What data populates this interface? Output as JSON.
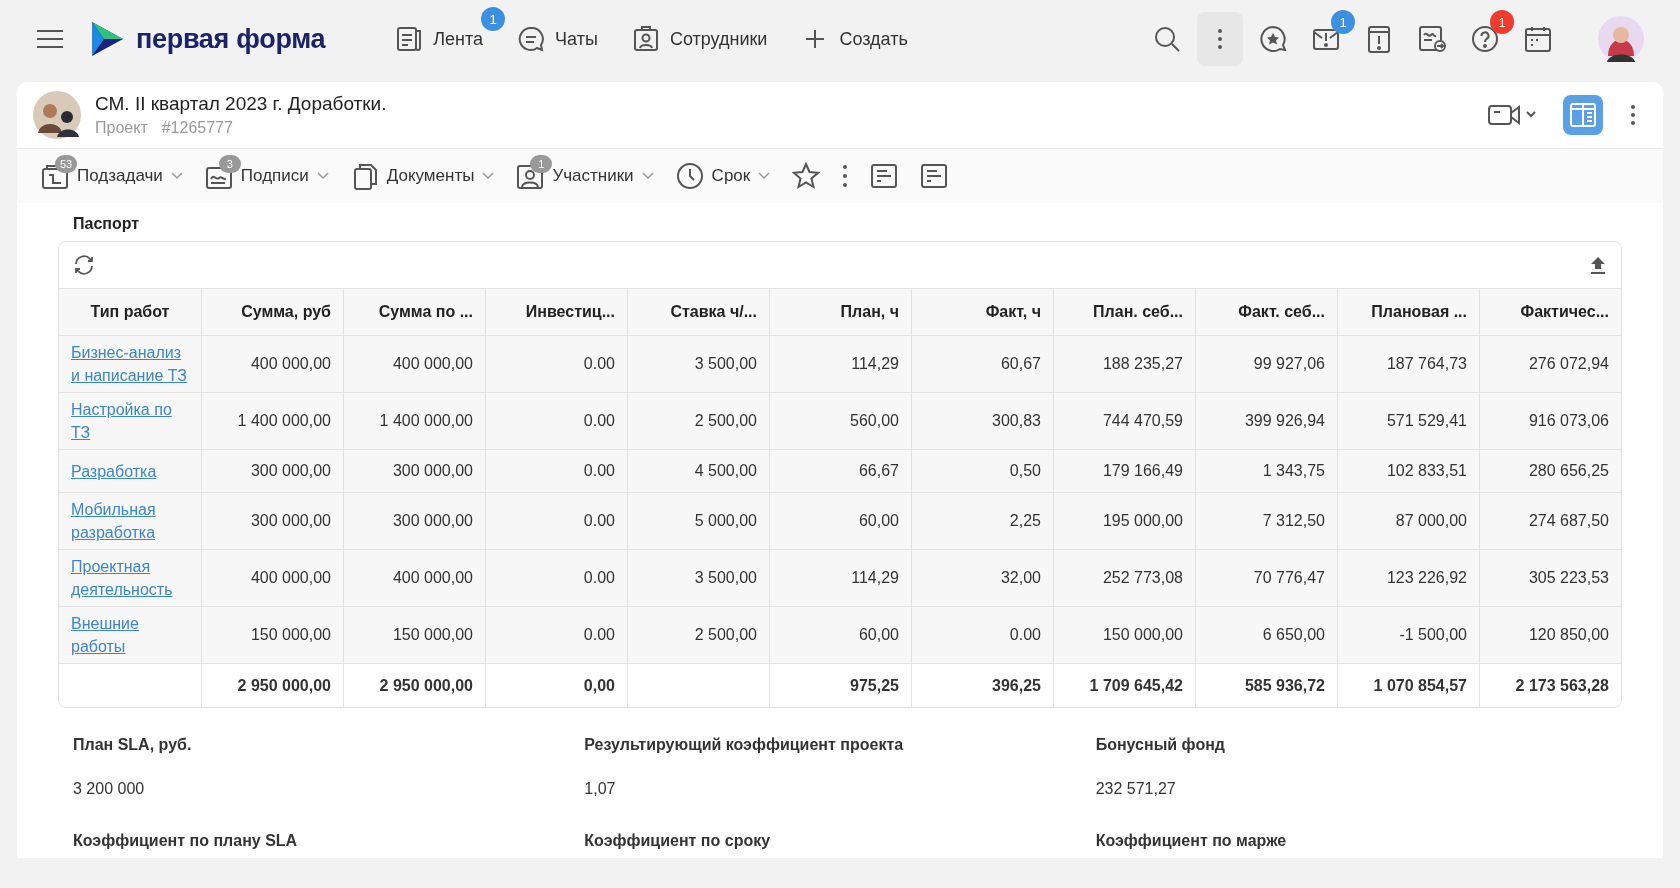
{
  "topbar": {
    "logo": "первая форма",
    "nav": [
      {
        "kind": "feed",
        "label": "Лента",
        "badge": "1"
      },
      {
        "kind": "chat",
        "label": "Чаты"
      },
      {
        "kind": "people",
        "label": "Сотрудники"
      },
      {
        "kind": "plus",
        "label": "Создать"
      }
    ],
    "actions": [
      {
        "kind": "search"
      },
      {
        "kind": "more"
      },
      {
        "kind": "star-chat"
      },
      {
        "kind": "mail-alert",
        "badge": "1",
        "color": "#3d8fe0"
      },
      {
        "kind": "alert-page"
      },
      {
        "kind": "sign"
      },
      {
        "kind": "help",
        "badge": "1",
        "color": "#f03a2e"
      },
      {
        "kind": "calendar"
      }
    ]
  },
  "header": {
    "title": "СМ. II квартал 2023 г. Доработки.",
    "type": "Проект",
    "number": "#1265777",
    "layout_selected": true
  },
  "toolbar": [
    {
      "kind": "subtasks",
      "label": "Подзадачи",
      "badge": "53"
    },
    {
      "kind": "signatures",
      "label": "Подписи",
      "badge": "3"
    },
    {
      "kind": "documents",
      "label": "Документы"
    },
    {
      "kind": "participants",
      "label": "Участники",
      "badge": "1"
    },
    {
      "kind": "deadline",
      "label": "Срок"
    },
    {
      "kind": "star"
    },
    {
      "kind": "more"
    },
    {
      "kind": "list"
    },
    {
      "kind": "list"
    }
  ],
  "section": {
    "title": "Паспорт"
  },
  "table": {
    "columns": [
      {
        "title": "Тип работ"
      },
      {
        "title": "Сумма, руб",
        "total": "2 950 000,00"
      },
      {
        "title": "Сумма по ...",
        "total": "2 950 000,00"
      },
      {
        "title": "Инвестиц...",
        "total": "0,00"
      },
      {
        "title": "Ставка ч/..."
      },
      {
        "title": "План, ч",
        "total": "975,25"
      },
      {
        "title": "Факт, ч",
        "total": "396,25"
      },
      {
        "title": "План. себ...",
        "total": "1 709 645,42"
      },
      {
        "title": "Факт. себ...",
        "total": "585 936,72"
      },
      {
        "title": "Плановая ...",
        "total": "1 070 854,57"
      },
      {
        "title": "Фактичес...",
        "total": "2 173 563,28"
      }
    ],
    "rows": [
      {
        "name": "Бизнес-анализ и написание ТЗ",
        "values": [
          "400 000,00",
          "400 000,00",
          "0.00",
          "3 500,00",
          "114,29",
          "60,67",
          "188 235,27",
          "99 927,06",
          "187 764,73",
          "276 072,94"
        ]
      },
      {
        "name": "Настройка по ТЗ",
        "values": [
          "1 400 000,00",
          "1 400 000,00",
          "0.00",
          "2 500,00",
          "560,00",
          "300,83",
          "744 470,59",
          "399 926,94",
          "571 529,41",
          "916 073,06"
        ]
      },
      {
        "name": "Разработка",
        "values": [
          "300 000,00",
          "300 000,00",
          "0.00",
          "4 500,00",
          "66,67",
          "0,50",
          "179 166,49",
          "1 343,75",
          "102 833,51",
          "280 656,25"
        ]
      },
      {
        "name": "Мобильная разработка",
        "values": [
          "300 000,00",
          "300 000,00",
          "0.00",
          "5 000,00",
          "60,00",
          "2,25",
          "195 000,00",
          "7 312,50",
          "87 000,00",
          "274 687,50"
        ]
      },
      {
        "name": "Проектная деятельность",
        "values": [
          "400 000,00",
          "400 000,00",
          "0.00",
          "3 500,00",
          "114,29",
          "32,00",
          "252 773,08",
          "70 776,47",
          "123 226,92",
          "305 223,53"
        ]
      },
      {
        "name": "Внешние работы",
        "values": [
          "150 000,00",
          "150 000,00",
          "0.00",
          "2 500,00",
          "60,00",
          "0.00",
          "150 000,00",
          "6 650,00",
          "-1 500,00",
          "120 850,00"
        ]
      }
    ]
  },
  "fields": [
    {
      "label": "План SLA, руб.",
      "value": "3 200 000"
    },
    {
      "label": "Результирующий коэффициент проекта",
      "value": "1,07"
    },
    {
      "label": "Бонусный фонд",
      "value": "232 571,27"
    },
    {
      "label": "Коэффициент по плану SLA"
    },
    {
      "label": "Коэффициент по сроку"
    },
    {
      "label": "Коэффициент по марже"
    }
  ]
}
